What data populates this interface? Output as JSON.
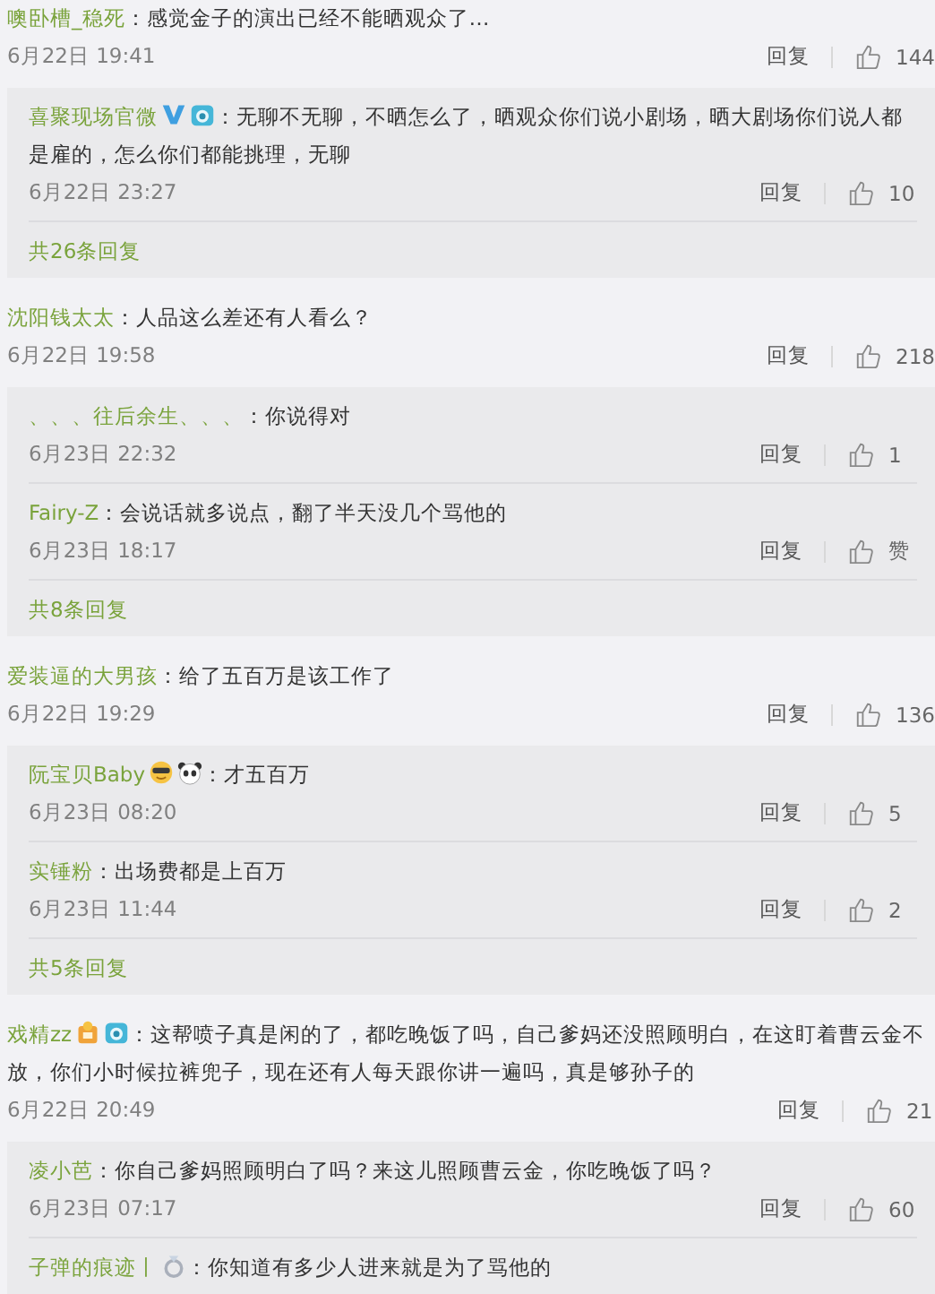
{
  "comments": [
    {
      "user": "噢卧槽_稳死",
      "text": "：感觉金子的演出已经不能晒观众了…",
      "time": "6月22日 19:41",
      "reply_label": "回复",
      "likes": "144",
      "replies": [
        {
          "user": "喜聚现场官微",
          "verified": true,
          "camera_badge": true,
          "text": "：无聊不无聊，不晒怎么了，晒观众你们说小剧场，晒大剧场你们说人都是雇的，怎么你们都能挑理，无聊",
          "time": "6月22日 23:27",
          "reply_label": "回复",
          "likes": "10"
        }
      ],
      "more": "共26条回复"
    },
    {
      "user": "沈阳钱太太",
      "text": "：人品这么差还有人看么？",
      "time": "6月22日 19:58",
      "reply_label": "回复",
      "likes": "218",
      "replies": [
        {
          "user": "、、、往后余生、、、",
          "text": "：你说得对",
          "time": "6月23日 22:32",
          "reply_label": "回复",
          "likes": "1"
        },
        {
          "user": "Fairy-Z",
          "text": "：会说话就多说点，翻了半天没几个骂他的",
          "time": "6月23日 18:17",
          "reply_label": "回复",
          "likes": "赞"
        }
      ],
      "more": "共8条回复"
    },
    {
      "user": "爱装逼的大男孩",
      "text": "：给了五百万是该工作了",
      "time": "6月22日 19:29",
      "reply_label": "回复",
      "likes": "136",
      "replies": [
        {
          "user": "阮宝贝Baby",
          "sunglasses_emoji": true,
          "panda_emoji": true,
          "text": "：才五百万",
          "time": "6月23日 08:20",
          "reply_label": "回复",
          "likes": "5"
        },
        {
          "user": "实锤粉",
          "text": "：出场费都是上百万",
          "time": "6月23日 11:44",
          "reply_label": "回复",
          "likes": "2"
        }
      ],
      "more": "共5条回复"
    },
    {
      "user": "戏精zz",
      "medal_badge": true,
      "camera_badge": true,
      "text": "：这帮喷子真是闲的了，都吃晚饭了吗，自己爹妈还没照顾明白，在这盯着曹云金不放，你们小时候拉裤兜子，现在还有人每天跟你讲一遍吗，真是够孙子的",
      "time": "6月22日 20:49",
      "reply_label": "回复",
      "likes": "21",
      "replies": [
        {
          "user": "凌小芭",
          "text": "：你自己爹妈照顾明白了吗？来这儿照顾曹云金，你吃晚饭了吗？",
          "time": "6月23日 07:17",
          "reply_label": "回复",
          "likes": "60"
        },
        {
          "user": "子弹的痕迹丨",
          "ring_badge": true,
          "text": "：你知道有多少人进来就是为了骂他的"
        }
      ]
    }
  ]
}
